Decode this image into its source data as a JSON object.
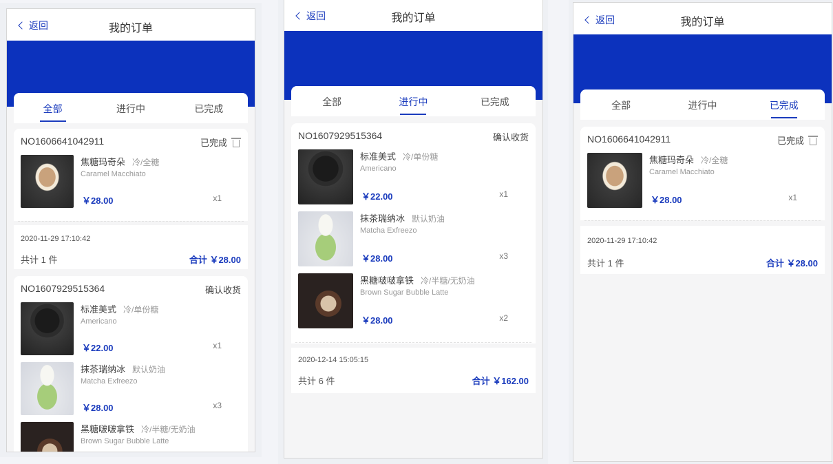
{
  "header": {
    "back_label": "返回",
    "title": "我的订单"
  },
  "tabs": [
    "全部",
    "进行中",
    "已完成"
  ],
  "orders": {
    "a": {
      "no": "NO1606641042911",
      "status": "已完成",
      "time": "2020-11-29 17:10:42",
      "count": "共计 1 件",
      "total": "合计 ￥28.00",
      "items": [
        {
          "name": "焦糖玛奇朵",
          "opt": "冷/全糖",
          "en": "Caramel Macchiato",
          "price": "￥28.00",
          "qty": "x1"
        }
      ]
    },
    "b": {
      "no": "NO1607929515364",
      "status": "确认收货",
      "time": "2020-12-14 15:05:15",
      "count": "共计 6 件",
      "total": "合计 ￥162.00",
      "items": [
        {
          "name": "标准美式",
          "opt": "冷/单份糖",
          "en": "Americano",
          "price": "￥22.00",
          "qty": "x1"
        },
        {
          "name": "抹茶瑞纳冰",
          "opt": "默认奶油",
          "en": "Matcha Exfreezo",
          "price": "￥28.00",
          "qty": "x3"
        },
        {
          "name": "黑糖啵啵拿铁",
          "opt": "冷/半糖/无奶油",
          "en": "Brown Sugar Bubble Latte",
          "price": "￥28.00",
          "qty": "x2"
        }
      ]
    }
  },
  "icons": [
    "back-chevron-icon",
    "trash-icon"
  ],
  "colors": {
    "accent": "#0c32bd",
    "text": "#333333"
  }
}
